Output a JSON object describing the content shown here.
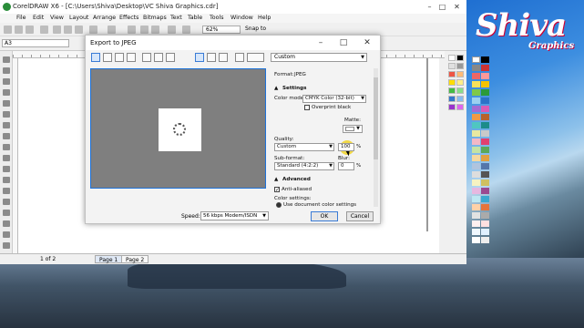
{
  "app": {
    "title": "CorelDRAW X6 - [C:\\Users\\Shiva\\Desktop\\VC Shiva Graphics.cdr]",
    "window_controls": [
      "–",
      "□",
      "✕"
    ],
    "menu": [
      "File",
      "Edit",
      "View",
      "Layout",
      "Arrange",
      "Effects",
      "Bitmaps",
      "Text",
      "Table",
      "Tools",
      "Window",
      "Help"
    ],
    "zoom": "62%",
    "snap_to": "Snap to",
    "page_size": "A3",
    "status": {
      "page_of": "1 of 2",
      "pages": [
        "Page 1",
        "Page 2"
      ]
    }
  },
  "logo": {
    "big": "Shiva",
    "small": "Graphics"
  },
  "dialog": {
    "title": "Export to JPEG",
    "preset": "Custom",
    "format_label": "Format:",
    "format_value": "JPEG",
    "settings_heading": "Settings",
    "color_mode_label": "Color mode:",
    "color_mode_value": "CMYK Color (32-bit)",
    "overprint_label": "Overprint black",
    "matte_label": "Matte:",
    "quality_label": "Quality:",
    "quality_value": "Custom",
    "quality_number": "100",
    "quality_unit": "%",
    "subformat_label": "Sub-format:",
    "subformat_value": "Standard (4:2:2)",
    "blur_label": "Blur:",
    "blur_value": "0",
    "blur_unit": "%",
    "advanced_heading": "Advanced",
    "antialiased_label": "Anti-aliased",
    "antialiased_checked": true,
    "color_settings_label": "Color settings:",
    "use_doc_color_label": "Use document color settings",
    "speed_label": "Speed:",
    "speed_value": "56 kbps Modem/ISDN",
    "ok_label": "OK",
    "cancel_label": "Cancel"
  },
  "colors": {
    "accent": "#1e72d8",
    "preview_bg": "#7f7f7f",
    "cursor_highlight": "#f0d228"
  }
}
